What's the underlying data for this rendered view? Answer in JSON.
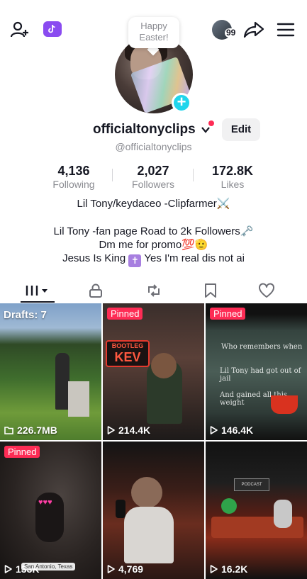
{
  "top_bar": {
    "follower_count_badge": "99",
    "icons": [
      "add-user-icon",
      "tiktok-studio-icon",
      "share-icon",
      "menu-icon"
    ]
  },
  "bubble": {
    "line1": "Happy",
    "line2": "Easter!"
  },
  "profile": {
    "username": "officialtonyclips",
    "handle": "@officialtonyclips",
    "edit_label": "Edit",
    "stats": {
      "following": {
        "value": "4,136",
        "label": "Following"
      },
      "followers": {
        "value": "2,027",
        "label": "Followers"
      },
      "likes": {
        "value": "172.8K",
        "label": "Likes"
      }
    },
    "bio": {
      "line1": "Lil Tony/keydaceo -Clipfarmer⚔️",
      "line2": "Lil Tony -fan page   Road to 2k Followers🗝️",
      "line3": "Dm me for promo💯🫡",
      "line4a": "Jesus Is King",
      "line4b": " Yes I'm real dis not ai"
    }
  },
  "tabs": [
    "videos-grid",
    "private",
    "reposts",
    "favorites",
    "liked"
  ],
  "grid": [
    {
      "badge": "Drafts: 7",
      "meta": "226.7MB",
      "meta_icon": "folder-icon"
    },
    {
      "badge": "Pinned",
      "meta": "214.4K",
      "meta_icon": "play-icon",
      "overlay": "BOOTLEG KEV"
    },
    {
      "badge": "Pinned",
      "meta": "146.4K",
      "meta_icon": "play-icon"
    },
    {
      "badge": "Pinned",
      "meta": "133K",
      "meta_icon": "play-icon",
      "location": "San Antonio, Texas"
    },
    {
      "badge": "",
      "meta": "4,769",
      "meta_icon": "play-icon"
    },
    {
      "badge": "",
      "meta": "16.2K",
      "meta_icon": "play-icon"
    }
  ]
}
